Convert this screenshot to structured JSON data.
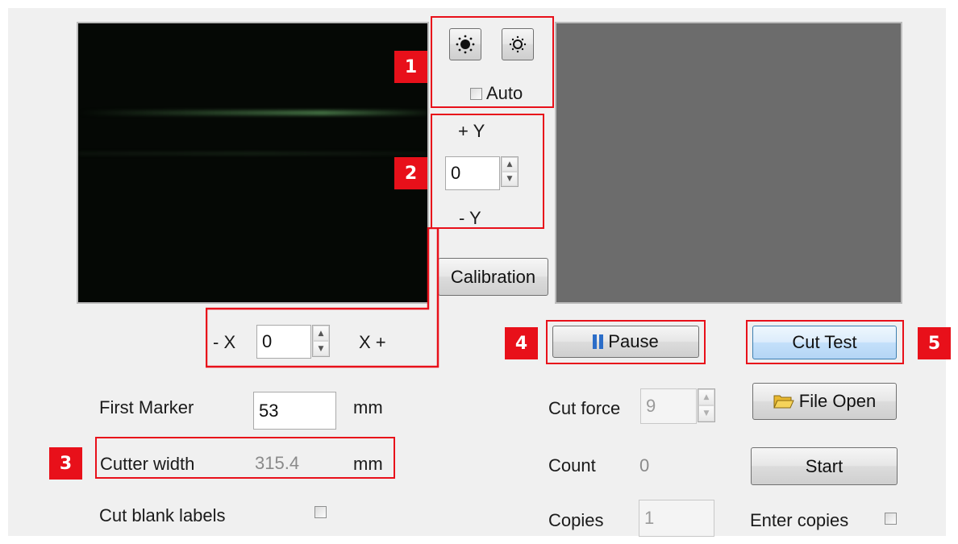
{
  "brightness": {
    "increase_icon": "sun-filled-icon",
    "decrease_icon": "sun-outline-icon",
    "auto_label": "Auto",
    "auto_checked": false
  },
  "y_offset": {
    "plus_label": "+ Y",
    "value": "0",
    "minus_label": "- Y"
  },
  "calibration_label": "Calibration",
  "x_offset": {
    "minus_label": "- X",
    "value": "0",
    "plus_label": "X +"
  },
  "pause_label": "Pause",
  "cut_test_label": "Cut Test",
  "file_open_label": "File Open",
  "start_label": "Start",
  "first_marker": {
    "label": "First Marker",
    "value": "53",
    "unit": "mm"
  },
  "cutter_width": {
    "label": "Cutter width",
    "value": "315.4",
    "unit": "mm"
  },
  "cut_blank": {
    "label": "Cut blank labels",
    "checked": false
  },
  "cut_force": {
    "label": "Cut force",
    "value": "9"
  },
  "count": {
    "label": "Count",
    "value": "0"
  },
  "copies": {
    "label": "Copies",
    "value": "1"
  },
  "enter_copies": {
    "label": "Enter copies",
    "checked": false
  },
  "callouts": [
    "1",
    "2",
    "3",
    "4",
    "5"
  ],
  "colors": {
    "callout_red": "#e8101a",
    "preview_gray": "#6c6c6c",
    "camera_bg": "#050805"
  }
}
